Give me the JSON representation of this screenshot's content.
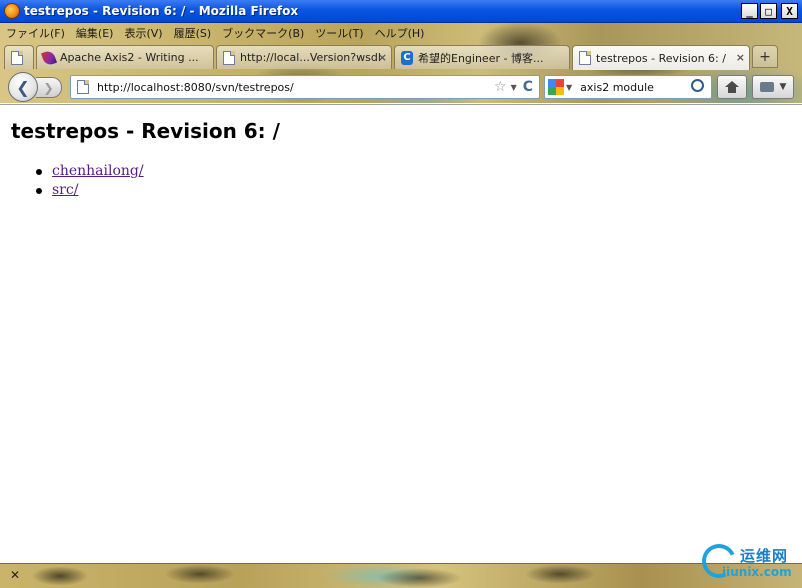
{
  "window": {
    "title": "testrepos - Revision 6: / - Mozilla Firefox",
    "buttons": {
      "minimize": "_",
      "maximize": "□",
      "close": "X"
    }
  },
  "menu": {
    "items": [
      "ファイル(F)",
      "編集(E)",
      "表示(V)",
      "履歴(S)",
      "ブックマーク(B)",
      "ツール(T)",
      "ヘルプ(H)"
    ]
  },
  "tabs": [
    {
      "label": "",
      "icon": "page-icon"
    },
    {
      "label": "Apache Axis2 - Writing ...",
      "icon": "feather-icon"
    },
    {
      "label": "http://local...Version?wsdl",
      "icon": "page-icon"
    },
    {
      "label": "希望的Engineer - 博客...",
      "icon": "csdn-icon"
    },
    {
      "label": "testrepos - Revision 6: /",
      "icon": "page-icon",
      "active": true
    }
  ],
  "tab_close_glyph": "×",
  "new_tab_glyph": "+",
  "nav": {
    "back_glyph": "❮",
    "forward_glyph": "❯",
    "url": "http://localhost:8080/svn/testrepos/",
    "star_glyph": "☆",
    "dropdown_glyph": "▼",
    "reload_glyph": "C",
    "search_text": "axis2 module"
  },
  "page": {
    "heading": "testrepos - Revision 6: /",
    "entries": [
      "chenhailong/",
      "src/"
    ]
  },
  "status": {
    "close_glyph": "✕"
  },
  "watermark": {
    "cn": "运维网",
    "en": "iiunix.com"
  },
  "colors": {
    "titlebar": "#0a55e0",
    "visited_link": "#551a8b",
    "watermark": "#1fa3dc"
  }
}
